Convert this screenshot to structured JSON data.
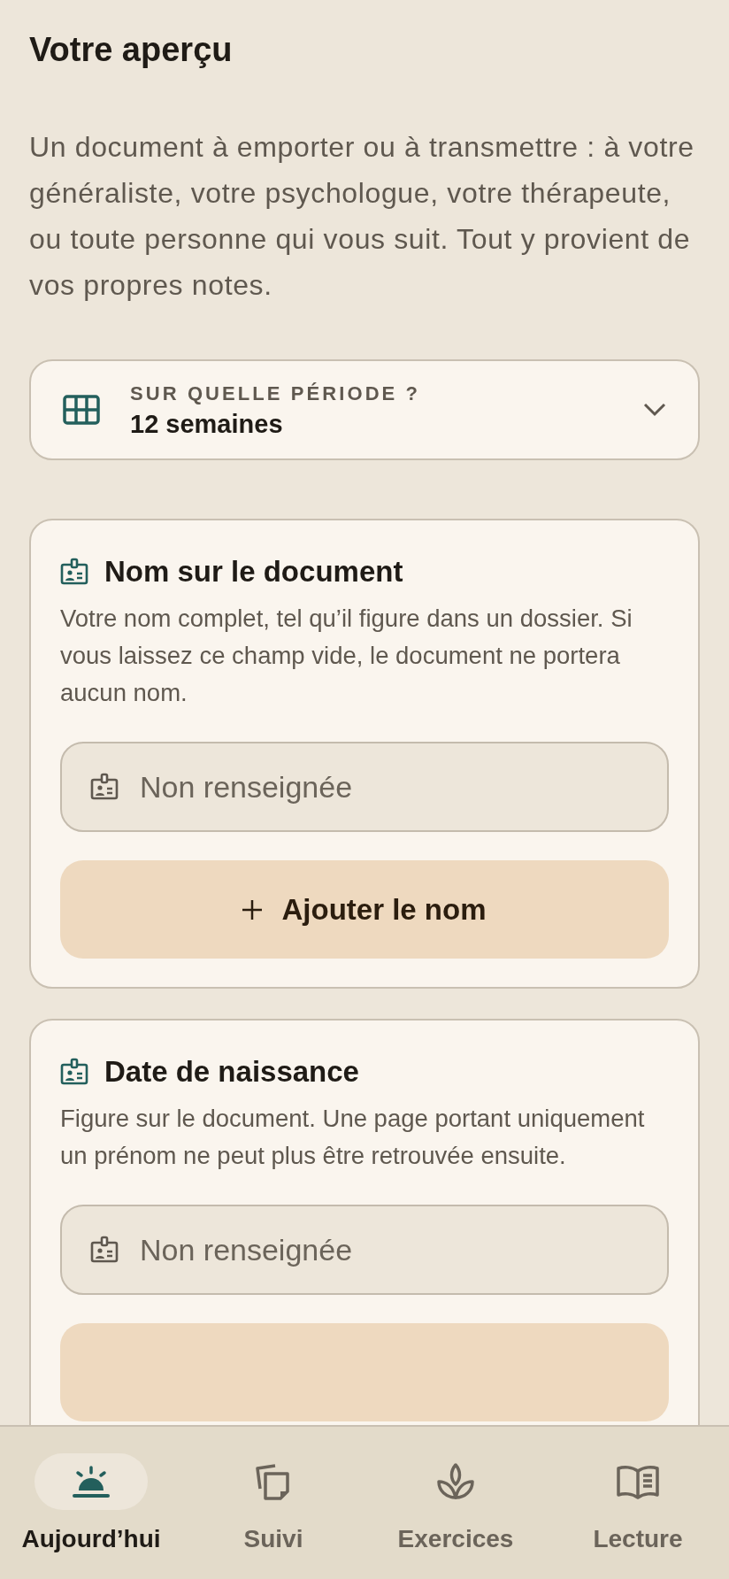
{
  "title": "Votre aperçu",
  "intro": "Un document à emporter ou à transmettre : à votre généraliste, votre psychologue, votre thérapeute, ou toute personne qui vous suit. Tout y provient de vos propres notes.",
  "period": {
    "label": "SUR QUELLE PÉRIODE ?",
    "value": "12 semaines"
  },
  "sections": [
    {
      "heading": "Nom sur le document",
      "description": "Votre nom complet, tel qu’il figure dans un dossier. Si vous laissez ce champ vide, le document ne portera aucun nom.",
      "placeholder": "Non renseignée",
      "action_label": "Ajouter le nom"
    },
    {
      "heading": "Date de naissance",
      "description": "Figure sur le document. Une page portant uniquement un prénom ne peut plus être retrouvée ensuite.",
      "placeholder": "Non renseignée"
    }
  ],
  "tabs": [
    {
      "label": "Aujourd’hui",
      "selected": true
    },
    {
      "label": "Suivi",
      "selected": false
    },
    {
      "label": "Exercices",
      "selected": false
    },
    {
      "label": "Lecture",
      "selected": false
    }
  ]
}
